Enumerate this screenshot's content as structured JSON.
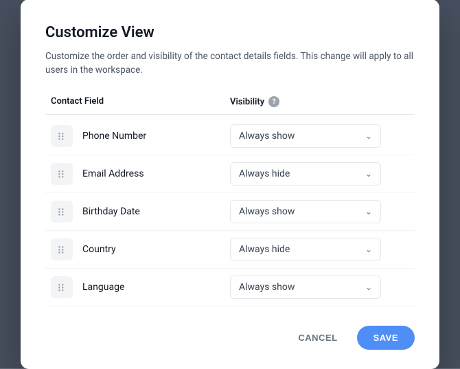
{
  "dialog": {
    "title": "Customize View",
    "description": "Customize the order and visibility of the contact details fields. This change will apply to all users in the workspace.",
    "table": {
      "col1_header": "Contact Field",
      "col2_header": "Visibility",
      "rows": [
        {
          "id": "phone",
          "field_name": "Phone Number",
          "visibility": "Always show"
        },
        {
          "id": "email",
          "field_name": "Email Address",
          "visibility": "Always hide"
        },
        {
          "id": "birthday",
          "field_name": "Birthday Date",
          "visibility": "Always show"
        },
        {
          "id": "country",
          "field_name": "Country",
          "visibility": "Always hide"
        },
        {
          "id": "language",
          "field_name": "Language",
          "visibility": "Always show"
        }
      ]
    },
    "footer": {
      "cancel_label": "CANCEL",
      "save_label": "SAVE"
    }
  }
}
